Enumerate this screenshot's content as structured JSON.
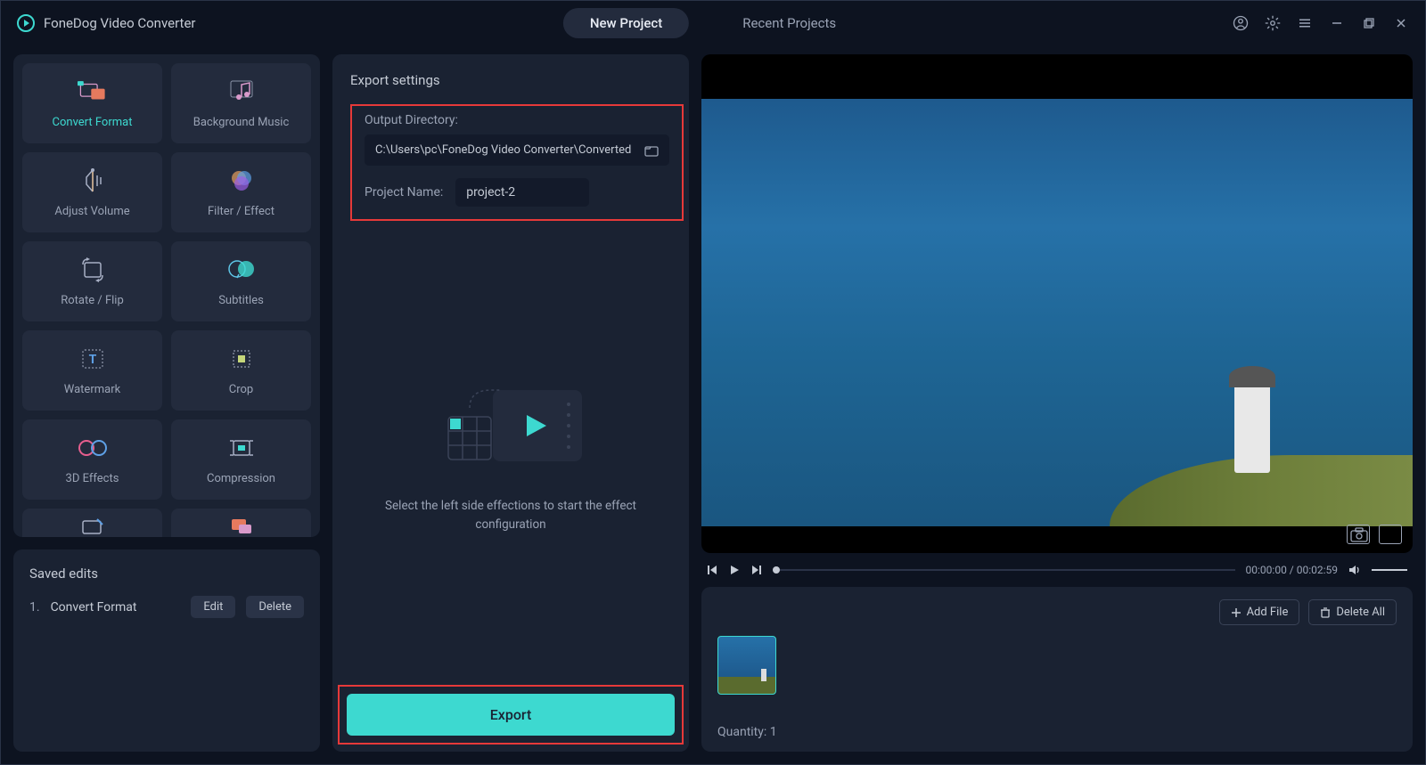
{
  "app": {
    "title": "FoneDog Video Converter"
  },
  "tabs": {
    "newProject": "New Project",
    "recentProjects": "Recent Projects"
  },
  "tools": [
    {
      "id": "convert-format",
      "label": "Convert Format",
      "active": true
    },
    {
      "id": "background-music",
      "label": "Background Music"
    },
    {
      "id": "adjust-volume",
      "label": "Adjust Volume"
    },
    {
      "id": "filter-effect",
      "label": "Filter / Effect"
    },
    {
      "id": "rotate-flip",
      "label": "Rotate / Flip"
    },
    {
      "id": "subtitles",
      "label": "Subtitles"
    },
    {
      "id": "watermark",
      "label": "Watermark"
    },
    {
      "id": "crop",
      "label": "Crop"
    },
    {
      "id": "3d-effects",
      "label": "3D Effects"
    },
    {
      "id": "compression",
      "label": "Compression"
    }
  ],
  "saved": {
    "title": "Saved edits",
    "items": [
      {
        "num": "1.",
        "name": "Convert Format"
      }
    ],
    "editLabel": "Edit",
    "deleteLabel": "Delete"
  },
  "export": {
    "sectionTitle": "Export settings",
    "outputDirLabel": "Output Directory:",
    "outputDirValue": "C:\\Users\\pc\\FoneDog Video Converter\\Converted",
    "projectNameLabel": "Project Name:",
    "projectNameValue": "project-2",
    "helpText": "Select the left side effections to start the effect configuration",
    "exportButton": "Export"
  },
  "player": {
    "currentTime": "00:00:00",
    "duration": "00:02:59",
    "separator": " / "
  },
  "clips": {
    "addFileLabel": "Add File",
    "deleteAllLabel": "Delete All",
    "quantityLabel": "Quantity: ",
    "quantityValue": "1"
  }
}
